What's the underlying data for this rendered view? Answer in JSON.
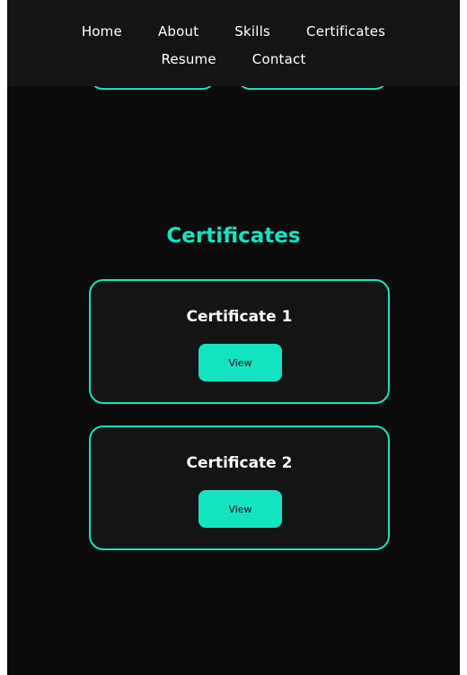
{
  "nav": {
    "items": [
      "Home",
      "About",
      "Skills",
      "Certificates",
      "Resume",
      "Contact"
    ]
  },
  "certificates": {
    "title": "Certificates",
    "cards": [
      {
        "title": "Certificate 1",
        "button_label": "View"
      },
      {
        "title": "Certificate 2",
        "button_label": "View"
      }
    ]
  },
  "colors": {
    "accent": "#14e3c2",
    "background": "#0b0b0b",
    "card": "#141414"
  }
}
